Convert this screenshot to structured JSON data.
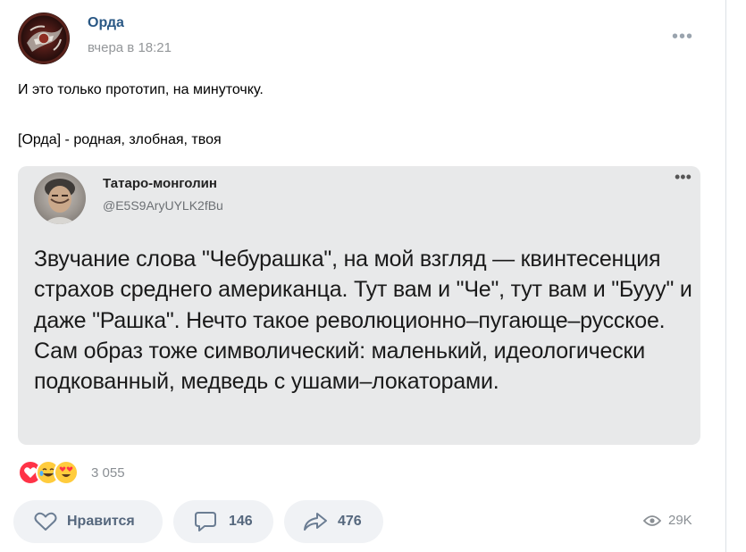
{
  "post": {
    "author": "Орда",
    "time": "вчера в 18:21",
    "more": "•••",
    "text_line1": "И это только прототип, на минуточку.",
    "text_line2": "[Орда] - родная, злобная, твоя"
  },
  "tweet": {
    "name": "Татаро-монголин",
    "handle": "@E5S9AryUYLK2fBu",
    "more": "•••",
    "body": "Звучание слова \"Чебурашка\", на мой взгляд — квинтесенция страхов среднего американца. Тут вам и \"Че\", тут вам и \"Бууу\" и даже \"Рашка\". Нечто такое революционно–пугающе–русское. Сам образ тоже символический: маленький, идеологически подкованный, медведь с ушами–локаторами."
  },
  "reactions": {
    "icons": [
      "heart-reaction",
      "laughing-tears-reaction",
      "heart-eyes-reaction"
    ],
    "count": "3 055"
  },
  "actions": {
    "like_label": "Нравится",
    "comments_count": "146",
    "shares_count": "476",
    "views_count": "29K"
  },
  "colors": {
    "author_link": "#2a5885",
    "action_text": "#55677d",
    "button_bg": "#f0f2f5",
    "card_bg": "#e8e9ea"
  }
}
